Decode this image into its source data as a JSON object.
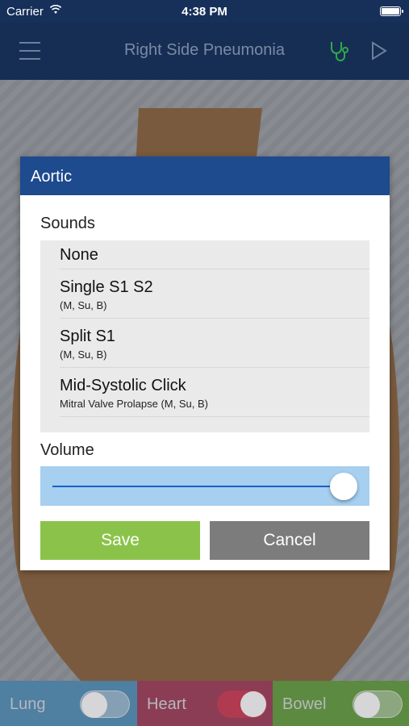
{
  "status_bar": {
    "carrier": "Carrier",
    "time": "4:38 PM"
  },
  "nav": {
    "title": "Right Side Pneumonia",
    "icons": [
      "menu-icon",
      "stethoscope-icon",
      "play-icon"
    ]
  },
  "dialog": {
    "title": "Aortic",
    "sounds_label": "Sounds",
    "sounds": [
      {
        "name": "None",
        "detail": ""
      },
      {
        "name": "Single S1 S2",
        "detail": "(M, Su, B)"
      },
      {
        "name": "Split S1",
        "detail": "(M, Su, B)"
      },
      {
        "name": "Mid-Systolic Click",
        "detail": "Mitral Valve Prolapse (M, Su, B)"
      }
    ],
    "volume_label": "Volume",
    "volume_level": 1.0,
    "save_label": "Save",
    "cancel_label": "Cancel"
  },
  "toggles": [
    {
      "label": "Lung",
      "on": false
    },
    {
      "label": "Heart",
      "on": true
    },
    {
      "label": "Bowel",
      "on": false
    }
  ],
  "colors": {
    "header": "#1e4a8e",
    "save": "#8bc34a",
    "cancel": "#7c7c7c",
    "lung": "#4f7fa1",
    "heart": "#8b3d55",
    "bowel": "#5c8a40"
  }
}
